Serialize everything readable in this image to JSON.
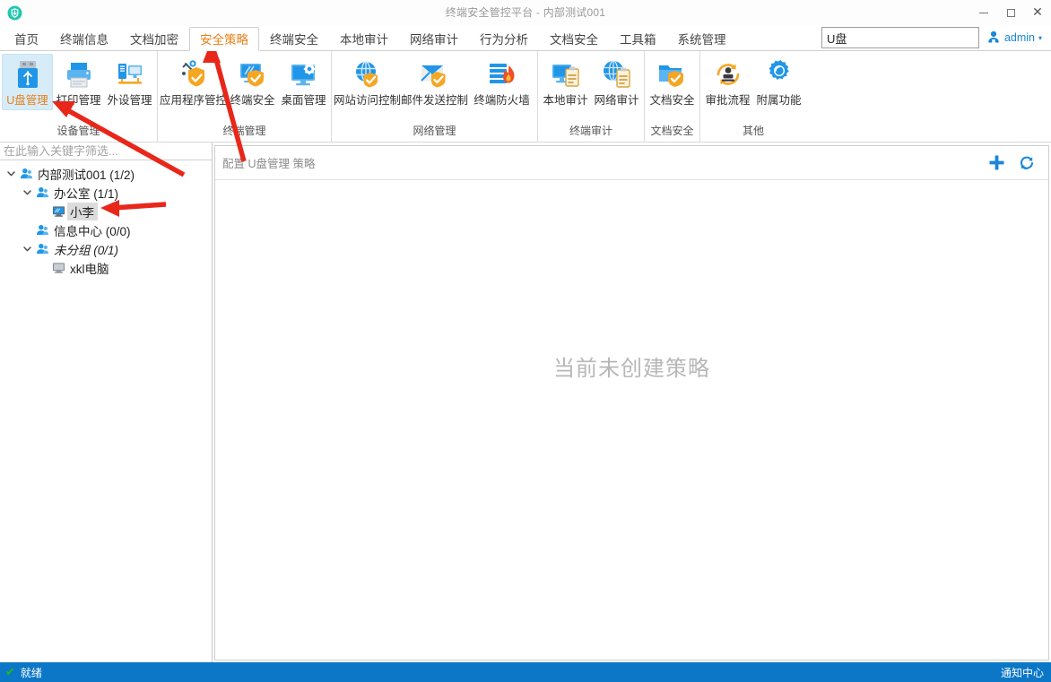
{
  "window": {
    "title": "终端安全管控平台 - 内部测试001",
    "logo_icon": "shield-icon",
    "minimize_label": "—",
    "maximize_label": "□",
    "close_label": "✕"
  },
  "menubar": {
    "items": [
      {
        "label": "首页",
        "active": false
      },
      {
        "label": "终端信息",
        "active": false
      },
      {
        "label": "文档加密",
        "active": false
      },
      {
        "label": "安全策略",
        "active": true
      },
      {
        "label": "终端安全",
        "active": false
      },
      {
        "label": "本地审计",
        "active": false
      },
      {
        "label": "网络审计",
        "active": false
      },
      {
        "label": "行为分析",
        "active": false
      },
      {
        "label": "文档安全",
        "active": false
      },
      {
        "label": "工具箱",
        "active": false
      },
      {
        "label": "系统管理",
        "active": false
      }
    ],
    "search": {
      "value": "U盘",
      "placeholder": ""
    },
    "user": {
      "name": "admin",
      "icon": "user-avatar-icon",
      "caret": "▾"
    }
  },
  "ribbon": {
    "groups": [
      {
        "label": "设备管理",
        "items": [
          {
            "label": "U盘管理",
            "icon": "usb-drive-icon",
            "selected": true
          },
          {
            "label": "打印管理",
            "icon": "printer-icon",
            "selected": false
          },
          {
            "label": "外设管理",
            "icon": "peripheral-device-icon",
            "selected": false
          }
        ]
      },
      {
        "label": "终端管理",
        "items": [
          {
            "label": "应用程序管控",
            "icon": "app-control-icon",
            "selected": false,
            "wide": true
          },
          {
            "label": "终端安全",
            "icon": "endpoint-security-icon",
            "selected": false
          },
          {
            "label": "桌面管理",
            "icon": "desktop-management-icon",
            "selected": false
          }
        ]
      },
      {
        "label": "网络管理",
        "items": [
          {
            "label": "网站访问控制",
            "icon": "website-access-control-icon",
            "selected": false,
            "wide": true
          },
          {
            "label": "邮件发送控制",
            "icon": "mail-control-icon",
            "selected": false,
            "wide": true
          },
          {
            "label": "终端防火墙",
            "icon": "firewall-icon",
            "selected": false,
            "wide": true
          }
        ]
      },
      {
        "label": "终端审计",
        "items": [
          {
            "label": "本地审计",
            "icon": "local-audit-icon",
            "selected": false
          },
          {
            "label": "网络审计",
            "icon": "network-audit-icon",
            "selected": false
          }
        ]
      },
      {
        "label": "文档安全",
        "items": [
          {
            "label": "文档安全",
            "icon": "document-security-icon",
            "selected": false
          }
        ]
      },
      {
        "label": "其他",
        "items": [
          {
            "label": "审批流程",
            "icon": "approval-workflow-icon",
            "selected": false
          },
          {
            "label": "附属功能",
            "icon": "extra-features-icon",
            "selected": false
          }
        ]
      }
    ]
  },
  "sidebar": {
    "filter": {
      "value": "",
      "placeholder": "在此输入关键字筛选..."
    },
    "tree": [
      {
        "label": "内部测试001 (1/2)",
        "depth": 0,
        "icon": "group-icon",
        "expanded": true,
        "has_twist": true,
        "selected": false,
        "italic": false
      },
      {
        "label": "办公室 (1/1)",
        "depth": 1,
        "icon": "group-icon",
        "expanded": true,
        "has_twist": true,
        "selected": false,
        "italic": false
      },
      {
        "label": "小李",
        "depth": 2,
        "icon": "computer-icon",
        "expanded": false,
        "has_twist": false,
        "selected": true,
        "italic": false
      },
      {
        "label": "信息中心 (0/0)",
        "depth": 1,
        "icon": "group-icon",
        "expanded": false,
        "has_twist": false,
        "selected": false,
        "italic": false
      },
      {
        "label": "未分组 (0/1)",
        "depth": 1,
        "icon": "group-icon",
        "expanded": true,
        "has_twist": true,
        "selected": false,
        "italic": true
      },
      {
        "label": "xkl电脑",
        "depth": 2,
        "icon": "computer-icon-gray",
        "expanded": false,
        "has_twist": false,
        "selected": false,
        "italic": false
      }
    ]
  },
  "main": {
    "breadcrumb": "配置 U盘管理 策略",
    "add_icon": "plus-icon",
    "refresh_icon": "refresh-icon",
    "empty_text": "当前未创建策略"
  },
  "statusbar": {
    "status_icon": "check-icon",
    "status_text": "就绪",
    "notification_text": "通知中心"
  },
  "colors": {
    "accent_blue": "#0c77c6",
    "active_tab_orange": "#e8801a",
    "selected_ribbon_bg": "#d6ecf8",
    "annotation_red": "#e8271a",
    "empty_text_gray": "#b7b7b7"
  }
}
